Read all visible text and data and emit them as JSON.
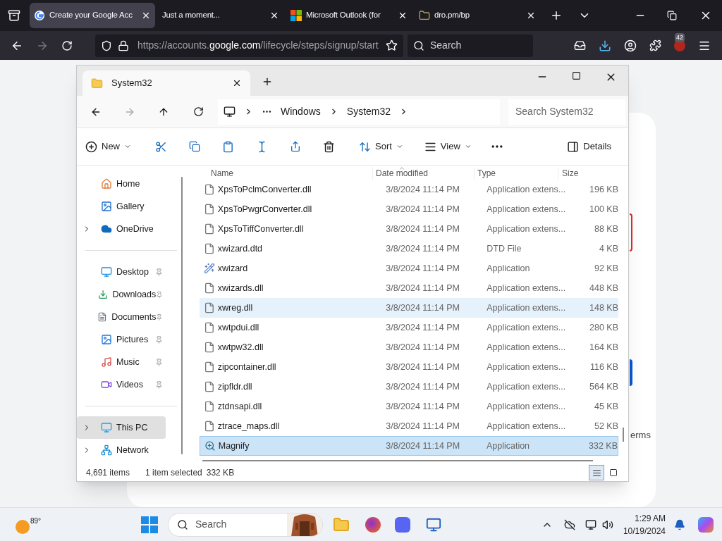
{
  "browser": {
    "tabs": [
      {
        "title": "Create your Google Acc",
        "kind": "google",
        "selected": true
      },
      {
        "title": "Just a moment...",
        "kind": "none",
        "selected": false
      },
      {
        "title": "Microsoft Outlook (for",
        "kind": "microsoft",
        "selected": false
      },
      {
        "title": "dro.pm/bp",
        "kind": "folder",
        "selected": false
      }
    ],
    "url_prefix": "https://accounts.",
    "url_domain": "google.com",
    "url_path": "/lifecycle/steps/signup/start",
    "search_placeholder": "Search",
    "extensions_badge": "42"
  },
  "page": {
    "visible_text": "erms"
  },
  "explorer": {
    "tab_title": "System32",
    "breadcrumb": [
      "Windows",
      "System32"
    ],
    "search_placeholder": "Search System32",
    "toolbar": {
      "new": "New",
      "sort": "Sort",
      "view": "View",
      "details": "Details"
    },
    "sidebar": [
      [
        {
          "label": "Home",
          "kind": "home",
          "pinned": false,
          "expandable": false,
          "selected": false
        },
        {
          "label": "Gallery",
          "kind": "gallery",
          "pinned": false,
          "expandable": false,
          "selected": false
        },
        {
          "label": "OneDrive",
          "kind": "cloud",
          "pinned": false,
          "expandable": true,
          "selected": false
        }
      ],
      [
        {
          "label": "Desktop",
          "kind": "desktop",
          "pinned": true,
          "expandable": false,
          "selected": false
        },
        {
          "label": "Downloads",
          "kind": "downloads",
          "pinned": true,
          "expandable": false,
          "selected": false
        },
        {
          "label": "Documents",
          "kind": "documents",
          "pinned": true,
          "expandable": false,
          "selected": false
        },
        {
          "label": "Pictures",
          "kind": "pictures",
          "pinned": true,
          "expandable": false,
          "selected": false
        },
        {
          "label": "Music",
          "kind": "music",
          "pinned": true,
          "expandable": false,
          "selected": false
        },
        {
          "label": "Videos",
          "kind": "videos",
          "pinned": true,
          "expandable": false,
          "selected": false
        }
      ],
      [
        {
          "label": "This PC",
          "kind": "pc",
          "pinned": false,
          "expandable": true,
          "selected": true
        },
        {
          "label": "Network",
          "kind": "network",
          "pinned": false,
          "expandable": true,
          "selected": false
        }
      ]
    ],
    "columns": [
      "Name",
      "Date modified",
      "Type",
      "Size"
    ],
    "rows": [
      {
        "name": "XpsToPclmConverter.dll",
        "date": "3/8/2024 11:14 PM",
        "type": "Application extens...",
        "size": "196 KB",
        "kind": "dll",
        "selected": false,
        "hovered": false
      },
      {
        "name": "XpsToPwgrConverter.dll",
        "date": "3/8/2024 11:14 PM",
        "type": "Application extens...",
        "size": "100 KB",
        "kind": "dll",
        "selected": false,
        "hovered": false
      },
      {
        "name": "XpsToTiffConverter.dll",
        "date": "3/8/2024 11:14 PM",
        "type": "Application extens...",
        "size": "88 KB",
        "kind": "dll",
        "selected": false,
        "hovered": false
      },
      {
        "name": "xwizard.dtd",
        "date": "3/8/2024 11:14 PM",
        "type": "DTD File",
        "size": "4 KB",
        "kind": "blank",
        "selected": false,
        "hovered": false
      },
      {
        "name": "xwizard",
        "date": "3/8/2024 11:14 PM",
        "type": "Application",
        "size": "92 KB",
        "kind": "app",
        "selected": false,
        "hovered": false
      },
      {
        "name": "xwizards.dll",
        "date": "3/8/2024 11:14 PM",
        "type": "Application extens...",
        "size": "448 KB",
        "kind": "dll",
        "selected": false,
        "hovered": false
      },
      {
        "name": "xwreg.dll",
        "date": "3/8/2024 11:14 PM",
        "type": "Application extens...",
        "size": "148 KB",
        "kind": "dll",
        "selected": false,
        "hovered": true
      },
      {
        "name": "xwtpdui.dll",
        "date": "3/8/2024 11:14 PM",
        "type": "Application extens...",
        "size": "280 KB",
        "kind": "dll",
        "selected": false,
        "hovered": false
      },
      {
        "name": "xwtpw32.dll",
        "date": "3/8/2024 11:14 PM",
        "type": "Application extens...",
        "size": "164 KB",
        "kind": "dll",
        "selected": false,
        "hovered": false
      },
      {
        "name": "zipcontainer.dll",
        "date": "3/8/2024 11:14 PM",
        "type": "Application extens...",
        "size": "116 KB",
        "kind": "dll",
        "selected": false,
        "hovered": false
      },
      {
        "name": "zipfldr.dll",
        "date": "3/8/2024 11:14 PM",
        "type": "Application extens...",
        "size": "564 KB",
        "kind": "dll",
        "selected": false,
        "hovered": false
      },
      {
        "name": "ztdnsapi.dll",
        "date": "3/8/2024 11:14 PM",
        "type": "Application extens...",
        "size": "45 KB",
        "kind": "dll",
        "selected": false,
        "hovered": false
      },
      {
        "name": "ztrace_maps.dll",
        "date": "3/8/2024 11:14 PM",
        "type": "Application extens...",
        "size": "52 KB",
        "kind": "dll",
        "selected": false,
        "hovered": false
      },
      {
        "name": "Magnify",
        "date": "3/8/2024 11:14 PM",
        "type": "Application",
        "size": "332 KB",
        "kind": "magnify",
        "selected": true,
        "hovered": false
      }
    ],
    "status": {
      "items": "4,691 items",
      "selection": "1 item selected",
      "size": "332 KB"
    },
    "view_modes": [
      {
        "kind": "details",
        "selected": true
      },
      {
        "kind": "tiles",
        "selected": false
      }
    ]
  },
  "taskbar": {
    "temperature": "89°",
    "search_placeholder": "Search",
    "time": "1:29 AM",
    "date": "10/19/2024"
  }
}
